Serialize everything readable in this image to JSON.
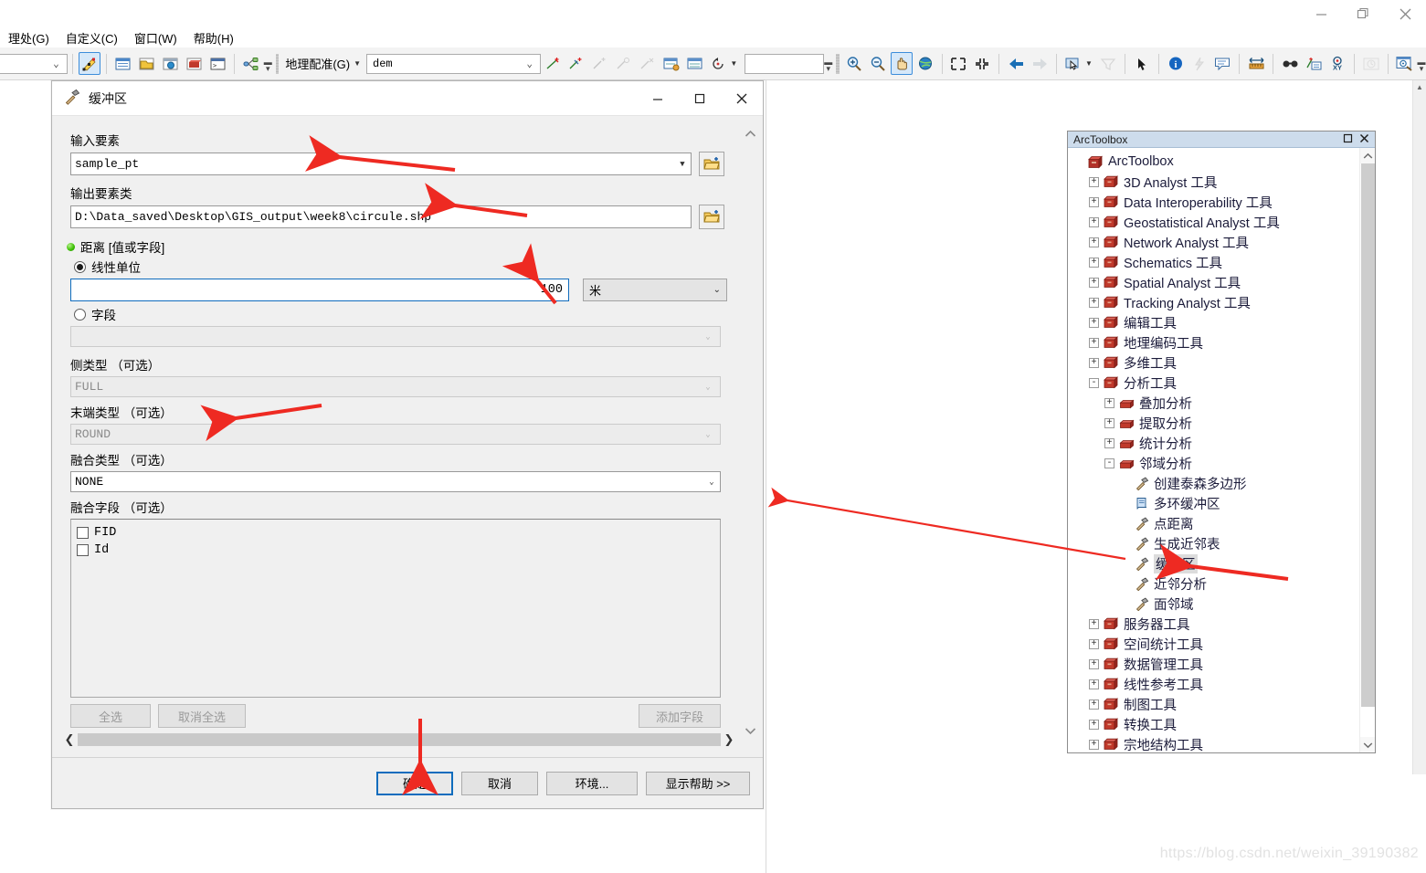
{
  "window": {
    "minimize": "—",
    "maximize": "❐",
    "close": "✕"
  },
  "menubar": {
    "items": [
      {
        "label": "理处(G)",
        "name": "menu-geoprocessing"
      },
      {
        "label": "自定义(C)",
        "name": "menu-customize"
      },
      {
        "label": "窗口(W)",
        "name": "menu-window"
      },
      {
        "label": "帮助(H)",
        "name": "menu-help"
      }
    ]
  },
  "toolbar": {
    "left_combo_value": "",
    "georef_label": "地理配准(G)",
    "layer_combo_value": "dem",
    "coord_box_value": ""
  },
  "dialog": {
    "title": "缓冲区",
    "title_icon": "hammer-tool-icon",
    "minimize": "—",
    "maximize": "☐",
    "close": "✕",
    "input_features": {
      "label": "输入要素",
      "value": "sample_pt"
    },
    "output_feature_class": {
      "label": "输出要素类",
      "value": "D:\\Data_saved\\Desktop\\GIS_output\\week8\\circule.shp"
    },
    "distance": {
      "label": "距离  [值或字段]",
      "linear_unit_label": "线性单位",
      "linear_unit_selected": true,
      "value": "100",
      "unit": "米",
      "field_label": "字段",
      "field_selected": false,
      "field_value": ""
    },
    "side_type": {
      "label": "侧类型 （可选）",
      "value": "FULL"
    },
    "end_type": {
      "label": "末端类型 （可选）",
      "value": "ROUND"
    },
    "dissolve_type": {
      "label": "融合类型 （可选）",
      "value": "NONE"
    },
    "dissolve_fields": {
      "label": "融合字段 （可选）",
      "items": [
        {
          "label": "FID",
          "checked": false
        },
        {
          "label": "Id",
          "checked": false
        }
      ],
      "select_all": "全选",
      "unselect_all": "取消全选",
      "add_field": "添加字段"
    },
    "footer_buttons": [
      {
        "label": "确定",
        "name": "ok-button",
        "primary": true
      },
      {
        "label": "取消",
        "name": "cancel-button",
        "primary": false
      },
      {
        "label": "环境...",
        "name": "environments-button",
        "primary": false
      },
      {
        "label": "显示帮助 >>",
        "name": "show-help-button",
        "primary": false
      }
    ]
  },
  "arctoolbox": {
    "panel_title": "ArcToolbox",
    "restore": "❐",
    "close": "✕",
    "tree": [
      {
        "label": "ArcToolbox",
        "depth": 0,
        "expander": "none",
        "icon": "toolbox-root-icon",
        "selected": false
      },
      {
        "label": "3D Analyst 工具",
        "depth": 1,
        "expander": "+",
        "icon": "toolbox-icon",
        "selected": false
      },
      {
        "label": "Data Interoperability 工具",
        "depth": 1,
        "expander": "+",
        "icon": "toolbox-icon",
        "selected": false
      },
      {
        "label": "Geostatistical Analyst 工具",
        "depth": 1,
        "expander": "+",
        "icon": "toolbox-icon",
        "selected": false
      },
      {
        "label": "Network Analyst 工具",
        "depth": 1,
        "expander": "+",
        "icon": "toolbox-icon",
        "selected": false
      },
      {
        "label": "Schematics 工具",
        "depth": 1,
        "expander": "+",
        "icon": "toolbox-icon",
        "selected": false
      },
      {
        "label": "Spatial Analyst 工具",
        "depth": 1,
        "expander": "+",
        "icon": "toolbox-icon",
        "selected": false
      },
      {
        "label": "Tracking Analyst 工具",
        "depth": 1,
        "expander": "+",
        "icon": "toolbox-icon",
        "selected": false
      },
      {
        "label": "编辑工具",
        "depth": 1,
        "expander": "+",
        "icon": "toolbox-icon",
        "selected": false
      },
      {
        "label": "地理编码工具",
        "depth": 1,
        "expander": "+",
        "icon": "toolbox-icon",
        "selected": false
      },
      {
        "label": "多维工具",
        "depth": 1,
        "expander": "+",
        "icon": "toolbox-icon",
        "selected": false
      },
      {
        "label": "分析工具",
        "depth": 1,
        "expander": "-",
        "icon": "toolbox-icon",
        "selected": false
      },
      {
        "label": "叠加分析",
        "depth": 2,
        "expander": "+",
        "icon": "toolset-icon",
        "selected": false
      },
      {
        "label": "提取分析",
        "depth": 2,
        "expander": "+",
        "icon": "toolset-icon",
        "selected": false
      },
      {
        "label": "统计分析",
        "depth": 2,
        "expander": "+",
        "icon": "toolset-icon",
        "selected": false
      },
      {
        "label": "邻域分析",
        "depth": 2,
        "expander": "-",
        "icon": "toolset-icon",
        "selected": false
      },
      {
        "label": "创建泰森多边形",
        "depth": 3,
        "expander": "none",
        "icon": "tool-icon",
        "selected": false
      },
      {
        "label": "多环缓冲区",
        "depth": 3,
        "expander": "none",
        "icon": "script-tool-icon",
        "selected": false
      },
      {
        "label": "点距离",
        "depth": 3,
        "expander": "none",
        "icon": "tool-icon",
        "selected": false
      },
      {
        "label": "生成近邻表",
        "depth": 3,
        "expander": "none",
        "icon": "tool-icon",
        "selected": false
      },
      {
        "label": "缓冲区",
        "depth": 3,
        "expander": "none",
        "icon": "tool-icon",
        "selected": true
      },
      {
        "label": "近邻分析",
        "depth": 3,
        "expander": "none",
        "icon": "tool-icon",
        "selected": false
      },
      {
        "label": "面邻域",
        "depth": 3,
        "expander": "none",
        "icon": "tool-icon",
        "selected": false
      },
      {
        "label": "服务器工具",
        "depth": 1,
        "expander": "+",
        "icon": "toolbox-icon",
        "selected": false
      },
      {
        "label": "空间统计工具",
        "depth": 1,
        "expander": "+",
        "icon": "toolbox-icon",
        "selected": false
      },
      {
        "label": "数据管理工具",
        "depth": 1,
        "expander": "+",
        "icon": "toolbox-icon",
        "selected": false
      },
      {
        "label": "线性参考工具",
        "depth": 1,
        "expander": "+",
        "icon": "toolbox-icon",
        "selected": false
      },
      {
        "label": "制图工具",
        "depth": 1,
        "expander": "+",
        "icon": "toolbox-icon",
        "selected": false
      },
      {
        "label": "转换工具",
        "depth": 1,
        "expander": "+",
        "icon": "toolbox-icon",
        "selected": false
      },
      {
        "label": "宗地结构工具",
        "depth": 1,
        "expander": "+",
        "icon": "toolbox-icon",
        "selected": false
      }
    ]
  },
  "watermark": {
    "text": "https://blog.csdn.net/weixin_39190382"
  },
  "annotations": {
    "arrow_color": "#ee2a22",
    "count": 5
  }
}
